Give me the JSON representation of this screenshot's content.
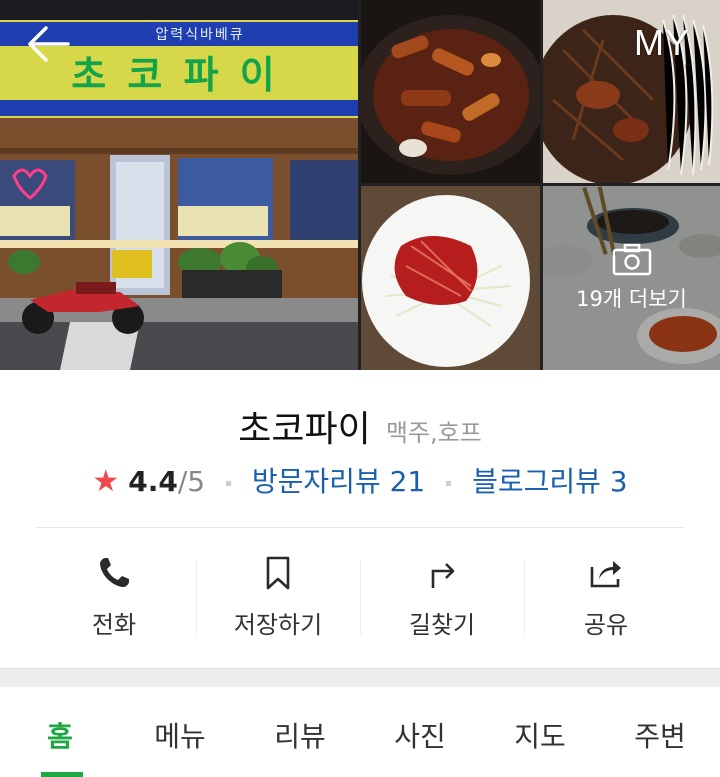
{
  "nav": {
    "my_label": "MY"
  },
  "gallery": {
    "storefront_sign": "초 코 파 이",
    "storefront_subsign": "압력식바베큐",
    "more_label": "19개 더보기"
  },
  "place": {
    "name": "초코파이",
    "category": "맥주,호프",
    "rating": "4.4",
    "rating_max": "/5",
    "visitor_reviews": "방문자리뷰 21",
    "blog_reviews": "블로그리뷰 3"
  },
  "actions": [
    {
      "label": "전화",
      "icon": "phone-icon"
    },
    {
      "label": "저장하기",
      "icon": "bookmark-icon"
    },
    {
      "label": "길찾기",
      "icon": "directions-icon"
    },
    {
      "label": "공유",
      "icon": "share-icon"
    }
  ],
  "tabs": [
    {
      "label": "홈",
      "active": true
    },
    {
      "label": "메뉴"
    },
    {
      "label": "리뷰"
    },
    {
      "label": "사진"
    },
    {
      "label": "지도"
    },
    {
      "label": "주변"
    }
  ],
  "colors": {
    "accent": "#1fa742",
    "link": "#1b5fb0",
    "star": "#f0484d"
  }
}
